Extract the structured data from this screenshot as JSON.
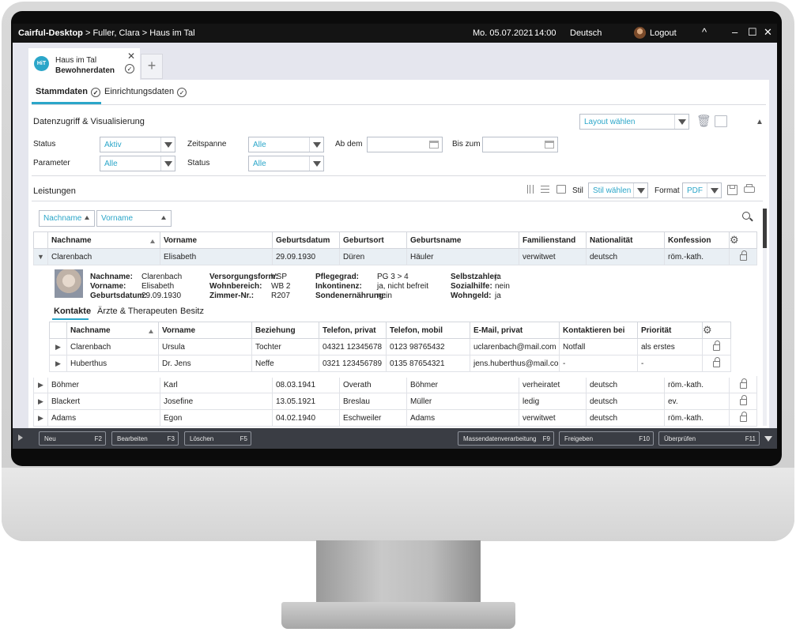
{
  "titlebar": {
    "app_name": "Cairful-Desktop",
    "path": " > Fuller, Clara > Haus im Tal",
    "date": "Mo. 05.07.2021",
    "time": "14:00",
    "language": "Deutsch",
    "logout": "Logout",
    "collapse_glyph": "^",
    "minimize_glyph": "–",
    "maximize_glyph": "☐",
    "close_glyph": "✕"
  },
  "doc_tab": {
    "badge": "HiT",
    "line1": "Haus im Tal",
    "line2": "Bewohnerdaten",
    "close_glyph": "✕",
    "check_glyph": "✓",
    "add_glyph": "+"
  },
  "subtabs": {
    "stammdaten": "Stammdaten",
    "einrichtungsdaten": "Einrichtungsdaten",
    "check_glyph": "✓"
  },
  "datenzugriff": {
    "title": "Datenzugriff & Visualisierung",
    "layout_select": "Layout wählen",
    "collapse_glyph": "▲",
    "status_label": "Status",
    "status_value": "Aktiv",
    "zeitspanne_label": "Zeitspanne",
    "zeitspanne_value": "Alle",
    "ab_dem_label": "Ab dem",
    "bis_zum_label": "Bis zum",
    "parameter_label": "Parameter",
    "parameter_value": "Alle",
    "status2_label": "Status",
    "status2_value": "Alle"
  },
  "leistungen": {
    "title": "Leistungen",
    "stil_label": "Stil",
    "stil_select": "Stil wählen",
    "format_label": "Format",
    "format_value": "PDF",
    "filter_nachname": "Nachname",
    "filter_vorname": "Vorname",
    "columns": [
      "Nachname",
      "Vorname",
      "Geburtsdatum",
      "Geburtsort",
      "Geburtsname",
      "Familienstand",
      "Nationalität",
      "Konfession"
    ],
    "selected_row": [
      "Clarenbach",
      "Elisabeth",
      "29.09.1930",
      "Düren",
      "Häuler",
      "verwitwet",
      "deutsch",
      "röm.-kath."
    ],
    "rows": [
      [
        "Böhmer",
        "Karl",
        "08.03.1941",
        "Overath",
        "Böhmer",
        "verheiratet",
        "deutsch",
        "röm.-kath."
      ],
      [
        "Blackert",
        "Josefine",
        "13.05.1921",
        "Breslau",
        "Müller",
        "ledig",
        "deutsch",
        "ev."
      ],
      [
        "Adams",
        "Egon",
        "04.02.1940",
        "Eschweiler",
        "Adams",
        "verwitwet",
        "deutsch",
        "röm.-kath."
      ]
    ]
  },
  "detail": {
    "nachname_label": "Nachname:",
    "nachname": "Clarenbach",
    "vorname_label": "Vorname:",
    "vorname": "Elisabeth",
    "geburtsdatum_label": "Geburtsdatum:",
    "geburtsdatum": "29.09.1930",
    "versorgungsform_label": "Versorgungsform:",
    "versorgungsform": "VSP",
    "wohnbereich_label": "Wohnbereich:",
    "wohnbereich": "WB 2",
    "zimmer_label": "Zimmer-Nr.:",
    "zimmer": "R207",
    "pflegegrad_label": "Pflegegrad:",
    "pflegegrad": "PG 3 > 4",
    "inkontinenz_label": "Inkontinenz:",
    "inkontinenz": "ja, nicht befreit",
    "sonden_label": "Sondenernährung:",
    "sonden": "nein",
    "selbstzahler_label": "Selbstzahler:",
    "selbstzahler": "ja",
    "sozialhilfe_label": "Sozialhilfe:",
    "sozialhilfe": "nein",
    "wohngeld_label": "Wohngeld:",
    "wohngeld": "ja",
    "tabs": [
      "Kontakte",
      "Ärzte & Therapeuten",
      "Besitz"
    ],
    "contact_columns": [
      "Nachname",
      "Vorname",
      "Beziehung",
      "Telefon, privat",
      "Telefon, mobil",
      "E-Mail, privat",
      "Kontaktieren bei",
      "Priorität"
    ],
    "contacts": [
      [
        "Clarenbach",
        "Ursula",
        "Tochter",
        "04321 12345678",
        "0123 98765432",
        "uclarenbach@mail.com",
        "Notfall",
        "als erstes"
      ],
      [
        "Huberthus",
        "Dr. Jens",
        "Neffe",
        "0321 123456789",
        "0135 87654321",
        "jens.huberthus@mail.com",
        "-",
        "-"
      ]
    ]
  },
  "footer": {
    "buttons": [
      {
        "label": "Neu",
        "key": "F2"
      },
      {
        "label": "Bearbeiten",
        "key": "F3"
      },
      {
        "label": "Löschen",
        "key": "F5"
      },
      {
        "label": "Massendatenverarbeitung",
        "key": "F9"
      },
      {
        "label": "Freigeben",
        "key": "F10"
      },
      {
        "label": "Überprüfen",
        "key": "F11"
      }
    ]
  },
  "glyphs": {
    "expand": "▶",
    "collapse": "▼",
    "gear": "⚙",
    "search": "⌕"
  }
}
